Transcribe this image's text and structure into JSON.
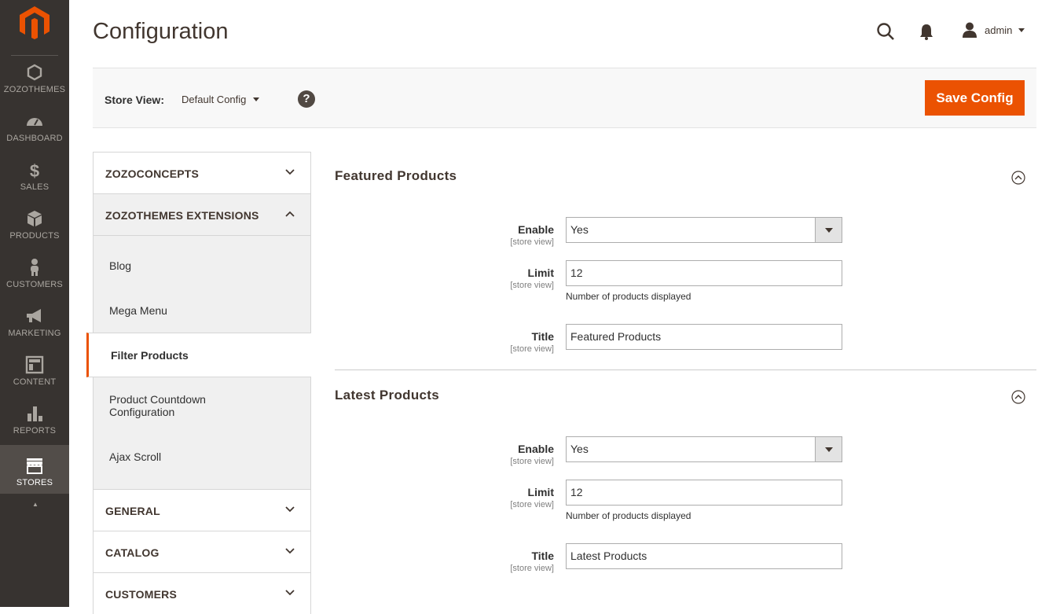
{
  "nav": {
    "items": [
      {
        "label": "ZOZOTHEMES",
        "icon": "hexagon-icon"
      },
      {
        "label": "DASHBOARD",
        "icon": "speedometer-icon"
      },
      {
        "label": "SALES",
        "icon": "dollar-icon"
      },
      {
        "label": "PRODUCTS",
        "icon": "box-icon"
      },
      {
        "label": "CUSTOMERS",
        "icon": "person-icon"
      },
      {
        "label": "MARKETING",
        "icon": "megaphone-icon"
      },
      {
        "label": "CONTENT",
        "icon": "layout-icon"
      },
      {
        "label": "REPORTS",
        "icon": "bar-chart-icon"
      },
      {
        "label": "STORES",
        "icon": "store-icon"
      }
    ],
    "active": "STORES",
    "scroll_glyph": "▲"
  },
  "header": {
    "title": "Configuration",
    "user": "admin"
  },
  "store_bar": {
    "label": "Store View:",
    "value": "Default Config",
    "help": "?",
    "save_label": "Save Config"
  },
  "sidebar": {
    "tabs": [
      {
        "label": "ZOZOCONCEPTS",
        "open": false
      },
      {
        "label": "ZOZOTHEMES EXTENSIONS",
        "open": true,
        "items": [
          "Blog",
          "Mega Menu",
          "Filter Products",
          "Product Countdown Configuration",
          "Ajax Scroll"
        ],
        "active_item": "Filter Products"
      },
      {
        "label": "GENERAL",
        "open": false
      },
      {
        "label": "CATALOG",
        "open": false
      },
      {
        "label": "CUSTOMERS",
        "open": false
      }
    ]
  },
  "sections": [
    {
      "title": "Featured Products",
      "fields": {
        "enable": {
          "label": "Enable",
          "scope": "[store view]",
          "value": "Yes"
        },
        "limit": {
          "label": "Limit",
          "scope": "[store view]",
          "value": "12",
          "note": "Number of products displayed"
        },
        "title": {
          "label": "Title",
          "scope": "[store view]",
          "value": "Featured Products"
        }
      }
    },
    {
      "title": "Latest Products",
      "fields": {
        "enable": {
          "label": "Enable",
          "scope": "[store view]",
          "value": "Yes"
        },
        "limit": {
          "label": "Limit",
          "scope": "[store view]",
          "value": "12",
          "note": "Number of products displayed"
        },
        "title": {
          "label": "Title",
          "scope": "[store view]",
          "value": "Latest Products"
        }
      }
    }
  ],
  "colors": {
    "accent": "#eb5202",
    "nav_bg": "#373330",
    "nav_active": "#524d49"
  }
}
